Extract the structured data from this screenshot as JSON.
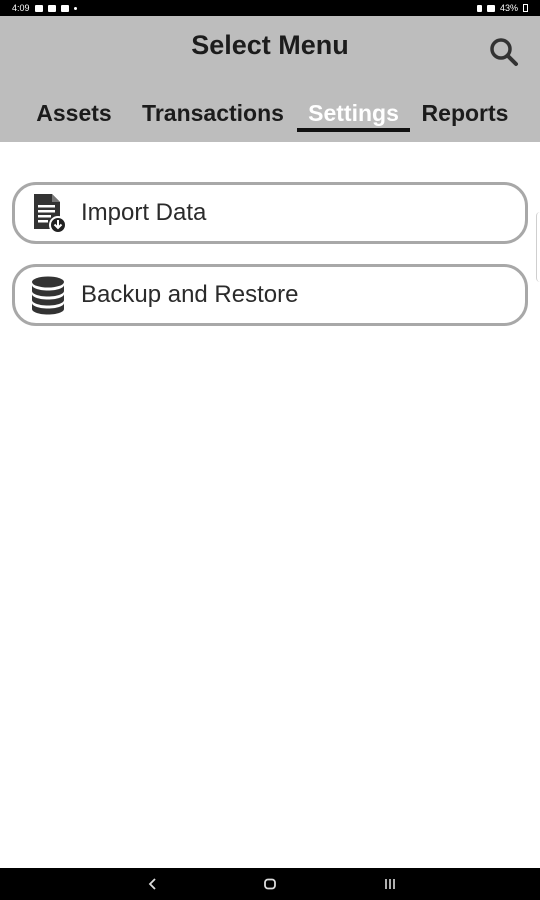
{
  "status_bar": {
    "time": "4:09",
    "battery": "43%"
  },
  "app_bar": {
    "title": "Select Menu",
    "search_icon": "search-icon"
  },
  "tabs": [
    {
      "label": "Assets",
      "active": false
    },
    {
      "label": "Transactions",
      "active": false
    },
    {
      "label": "Settings",
      "active": true
    },
    {
      "label": "Reports",
      "active": false
    }
  ],
  "menu": {
    "items": [
      {
        "label": "Import Data",
        "icon": "import-document-icon"
      },
      {
        "label": "Backup and Restore",
        "icon": "database-icon"
      }
    ]
  },
  "nav_bar": {
    "buttons": [
      "back-icon",
      "home-icon",
      "recents-icon"
    ]
  },
  "colors": {
    "app_bar_bg": "#bdbdbd",
    "active_tab_text": "#ffffff",
    "tab_text": "#1c1c1c",
    "menu_border": "#a8a8a8"
  }
}
